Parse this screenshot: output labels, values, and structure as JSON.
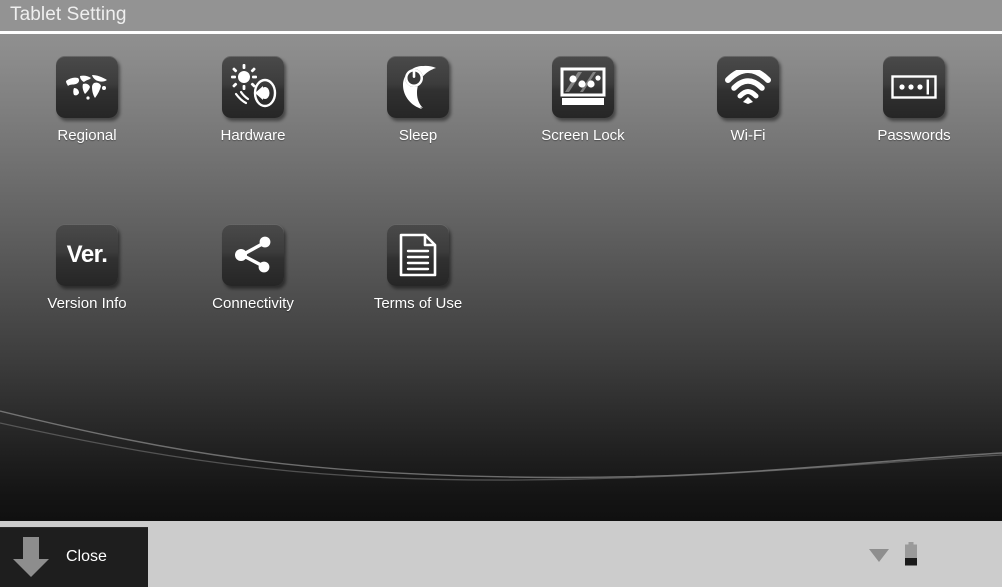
{
  "window": {
    "title": "Tablet Setting"
  },
  "colors": {
    "titlebar_bg": "#939393",
    "titlebar_text": "#efefef",
    "content_top": "#909090",
    "content_bottom": "#101010",
    "tile_bg": "#3c3c3c",
    "label_text": "#ffffff",
    "bottombar_bg": "#cccccc",
    "close_button_bg": "#1e1e1e",
    "status_icon": "#8e8e8e"
  },
  "grid": {
    "items": [
      {
        "label": "Regional",
        "icon": "world-map-icon",
        "row": 0,
        "col": 0
      },
      {
        "label": "Hardware",
        "icon": "brightness-sound-icon",
        "row": 0,
        "col": 1
      },
      {
        "label": "Sleep",
        "icon": "moon-power-icon",
        "row": 0,
        "col": 2
      },
      {
        "label": "Screen Lock",
        "icon": "screen-lock-icon",
        "row": 0,
        "col": 3
      },
      {
        "label": "Wi-Fi",
        "icon": "wifi-icon",
        "row": 0,
        "col": 4
      },
      {
        "label": "Passwords",
        "icon": "password-field-icon",
        "row": 0,
        "col": 5
      },
      {
        "label": "Version Info",
        "icon": "version-text-icon",
        "row": 1,
        "col": 0,
        "tile_text": "Ver."
      },
      {
        "label": "Connectivity",
        "icon": "share-nodes-icon",
        "row": 1,
        "col": 1
      },
      {
        "label": "Terms of Use",
        "icon": "document-lines-icon",
        "row": 1,
        "col": 2
      }
    ]
  },
  "bottom_bar": {
    "close_label": "Close",
    "close_icon": "down-arrow-icon",
    "status_icons": [
      {
        "name": "wifi-status-icon"
      },
      {
        "name": "battery-status-icon"
      }
    ]
  }
}
